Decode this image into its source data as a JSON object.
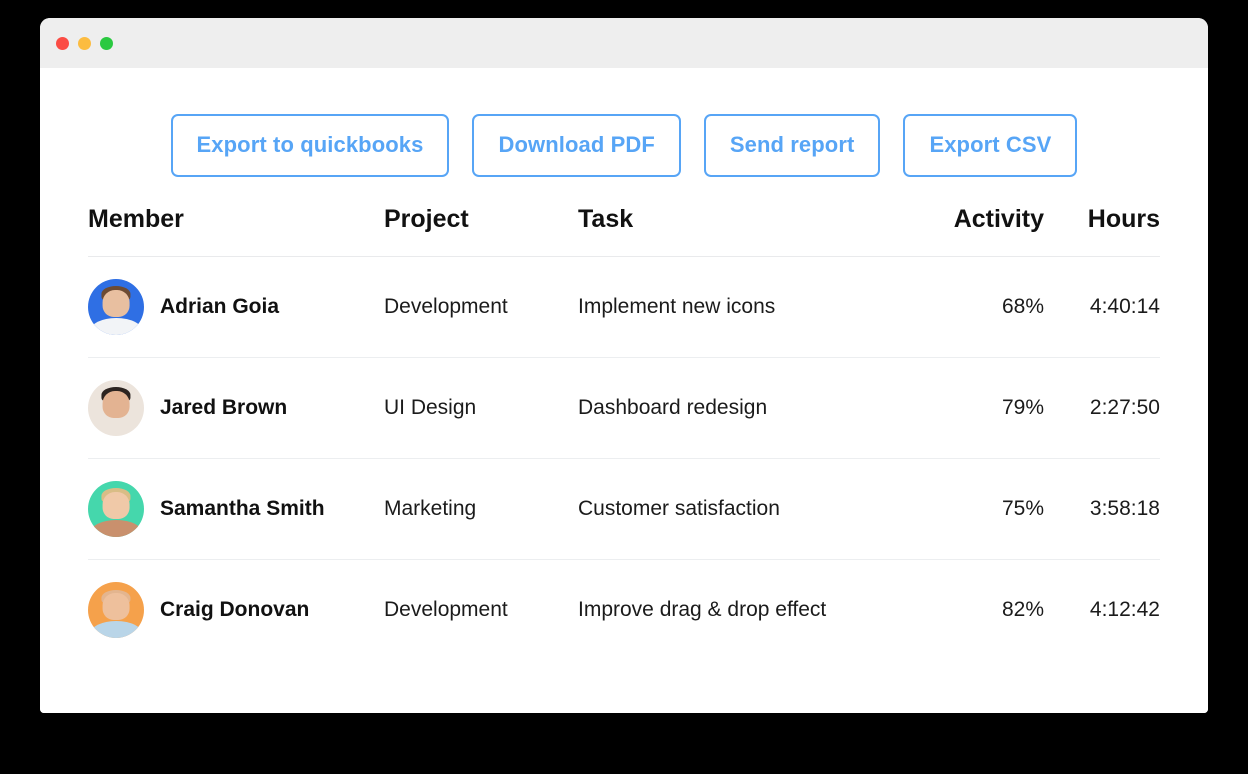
{
  "window": {
    "traffic_lights": [
      {
        "name": "close",
        "color": "#fb4c44"
      },
      {
        "name": "minimize",
        "color": "#fcbc40"
      },
      {
        "name": "maximize",
        "color": "#2ac940"
      }
    ]
  },
  "toolbar": {
    "buttons": [
      {
        "label": "Export to quickbooks",
        "name": "export-to-quickbooks-button"
      },
      {
        "label": "Download PDF",
        "name": "download-pdf-button"
      },
      {
        "label": "Send report",
        "name": "send-report-button"
      },
      {
        "label": "Export CSV",
        "name": "export-csv-button"
      }
    ],
    "accent_color": "#57a5f6"
  },
  "table": {
    "headers": {
      "member": "Member",
      "project": "Project",
      "task": "Task",
      "activity": "Activity",
      "hours": "Hours"
    },
    "rows": [
      {
        "member": "Adrian Goia",
        "project": "Development",
        "task": "Implement new icons",
        "activity": "68%",
        "hours": "4:40:14",
        "avatar": {
          "name": "avatar-adrian-goia",
          "bg": "#2f6fe4",
          "skin": "#e8bfa0",
          "hair": "#6d4b33",
          "torso": "#f2f4f7"
        }
      },
      {
        "member": "Jared Brown",
        "project": "UI Design",
        "task": "Dashboard redesign",
        "activity": "79%",
        "hours": "2:27:50",
        "avatar": {
          "name": "avatar-jared-brown",
          "bg": "#ece4dc",
          "skin": "#e3b392",
          "hair": "#2c2420",
          "torso": "#d munge"
        }
      },
      {
        "member": "Samantha Smith",
        "project": "Marketing",
        "task": "Customer satisfaction",
        "activity": "75%",
        "hours": "3:58:18",
        "avatar": {
          "name": "avatar-samantha-smith",
          "bg": "#45d7ac",
          "skin": "#f0c9a8",
          "hair": "#d9bd86",
          "torso": "#c9906d"
        }
      },
      {
        "member": "Craig Donovan",
        "project": "Development",
        "task": "Improve drag & drop effect",
        "activity": "82%",
        "hours": "4:12:42",
        "avatar": {
          "name": "avatar-craig-donovan",
          "bg": "#f5a14b",
          "skin": "#eec09c",
          "hair": "#e3b58f",
          "torso": "#b9d5e8"
        }
      }
    ]
  }
}
